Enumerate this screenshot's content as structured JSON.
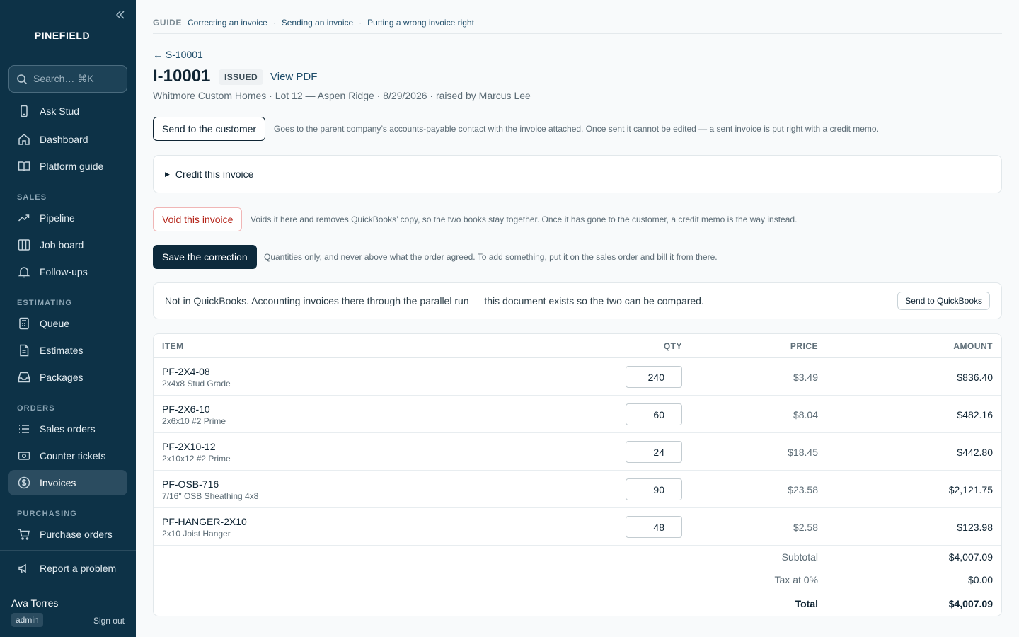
{
  "brand": "PINEFIELD",
  "search": {
    "placeholder": "Search…  ⌘K"
  },
  "sidebar": {
    "top_items": [
      {
        "label": "Ask Stud",
        "icon": "phone-icon"
      },
      {
        "label": "Dashboard",
        "icon": "home-icon"
      },
      {
        "label": "Platform guide",
        "icon": "book-icon"
      }
    ],
    "sections": [
      {
        "title": "SALES",
        "items": [
          {
            "label": "Pipeline",
            "icon": "trend-icon"
          },
          {
            "label": "Job board",
            "icon": "columns-icon"
          },
          {
            "label": "Follow-ups",
            "icon": "bell-icon"
          }
        ]
      },
      {
        "title": "ESTIMATING",
        "items": [
          {
            "label": "Queue",
            "icon": "calculator-icon"
          },
          {
            "label": "Estimates",
            "icon": "file-icon"
          },
          {
            "label": "Packages",
            "icon": "inbox-icon"
          }
        ]
      },
      {
        "title": "ORDERS",
        "items": [
          {
            "label": "Sales orders",
            "icon": "list-icon"
          },
          {
            "label": "Counter tickets",
            "icon": "cash-icon"
          },
          {
            "label": "Invoices",
            "icon": "dollar-icon"
          }
        ]
      },
      {
        "title": "PURCHASING",
        "items": [
          {
            "label": "Purchase orders",
            "icon": "cart-icon"
          }
        ]
      }
    ],
    "active": "Invoices",
    "report": "Report a problem",
    "user": {
      "name": "Ava Torres",
      "role": "admin",
      "signout": "Sign out"
    }
  },
  "guide": {
    "label": "GUIDE",
    "links": [
      "Correcting an invoice",
      "Sending an invoice",
      "Putting a wrong invoice right"
    ]
  },
  "invoice": {
    "back": "← S-10001",
    "number": "I-10001",
    "status": "ISSUED",
    "view_pdf": "View PDF",
    "subtitle": "Whitmore Custom Homes · Lot 12 — Aspen Ridge · 8/29/2026 · raised by Marcus Lee"
  },
  "actions": {
    "send_label": "Send to the customer",
    "send_hint": "Goes to the parent company’s accounts-payable contact with the invoice attached. Once sent it cannot be edited — a sent invoice is put right with a credit memo.",
    "credit_summary": "Credit this invoice",
    "void_label": "Void this invoice",
    "void_hint": "Voids it here and removes QuickBooks’ copy, so the two books stay together. Once it has gone to the customer, a credit memo is the way instead.",
    "save_label": "Save the correction",
    "save_hint": "Quantities only, and never above what the order agreed. To add something, put it on the sales order and bill it from there."
  },
  "quickbooks": {
    "text": "Not in QuickBooks. Accounting invoices there through the parallel run — this document exists so the two can be compared.",
    "button": "Send to QuickBooks"
  },
  "table": {
    "headers": {
      "item": "ITEM",
      "qty": "QTY",
      "price": "PRICE",
      "amount": "AMOUNT"
    },
    "rows": [
      {
        "sku": "PF-2X4-08",
        "desc": "2x4x8 Stud Grade",
        "qty": "240",
        "price": "$3.49",
        "amount": "$836.40"
      },
      {
        "sku": "PF-2X6-10",
        "desc": "2x6x10 #2 Prime",
        "qty": "60",
        "price": "$8.04",
        "amount": "$482.16"
      },
      {
        "sku": "PF-2X10-12",
        "desc": "2x10x12 #2 Prime",
        "qty": "24",
        "price": "$18.45",
        "amount": "$442.80"
      },
      {
        "sku": "PF-OSB-716",
        "desc": "7/16\" OSB Sheathing 4x8",
        "qty": "90",
        "price": "$23.58",
        "amount": "$2,121.75"
      },
      {
        "sku": "PF-HANGER-2X10",
        "desc": "2x10 Joist Hanger",
        "qty": "48",
        "price": "$2.58",
        "amount": "$123.98"
      }
    ],
    "subtotal_label": "Subtotal",
    "subtotal": "$4,007.09",
    "tax_label": "Tax at 0%",
    "tax": "$0.00",
    "total_label": "Total",
    "total": "$4,007.09"
  }
}
